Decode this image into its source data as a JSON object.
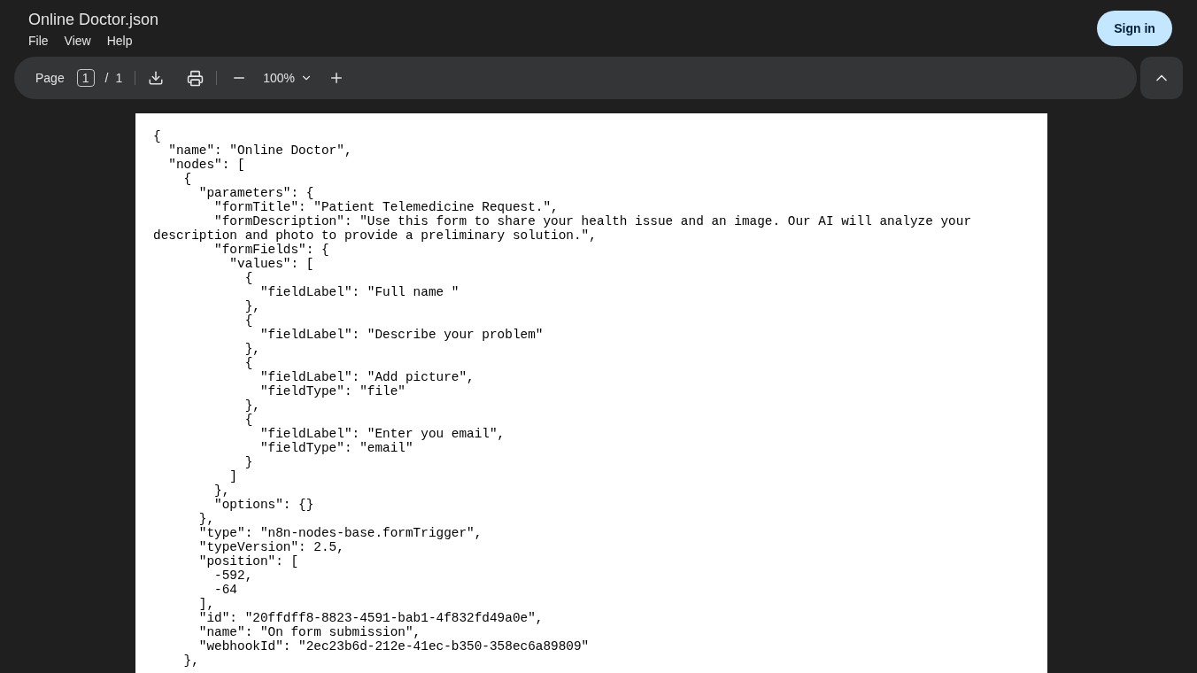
{
  "window": {
    "title": "Online Doctor.json"
  },
  "menu": [
    "File",
    "View",
    "Help"
  ],
  "sign_in": "Sign in",
  "toolbar": {
    "page_label": "Page",
    "page_value": "1",
    "page_separator": "/",
    "page_total": "1",
    "zoom": "100%"
  },
  "document": {
    "lines": [
      "{",
      "  \"name\": \"Online Doctor\",",
      "  \"nodes\": [",
      "    {",
      "      \"parameters\": {",
      "        \"formTitle\": \"Patient Telemedicine Request.\",",
      "        \"formDescription\": \"Use this form to share your health issue and an image. Our AI will analyze your",
      "description and photo to provide a preliminary solution.\",",
      "        \"formFields\": {",
      "          \"values\": [",
      "            {",
      "              \"fieldLabel\": \"Full name \"",
      "            },",
      "            {",
      "              \"fieldLabel\": \"Describe your problem\"",
      "            },",
      "            {",
      "              \"fieldLabel\": \"Add picture\",",
      "              \"fieldType\": \"file\"",
      "            },",
      "            {",
      "              \"fieldLabel\": \"Enter you email\",",
      "              \"fieldType\": \"email\"",
      "            }",
      "          ]",
      "        },",
      "        \"options\": {}",
      "      },",
      "      \"type\": \"n8n-nodes-base.formTrigger\",",
      "      \"typeVersion\": 2.5,",
      "      \"position\": [",
      "        -592,",
      "        -64",
      "      ],",
      "      \"id\": \"20ffdff8-8823-4591-bab1-4f832fd49a0e\",",
      "      \"name\": \"On form submission\",",
      "      \"webhookId\": \"2ec23b6d-212e-41ec-b350-358ec6a89809\"",
      "    },"
    ]
  }
}
